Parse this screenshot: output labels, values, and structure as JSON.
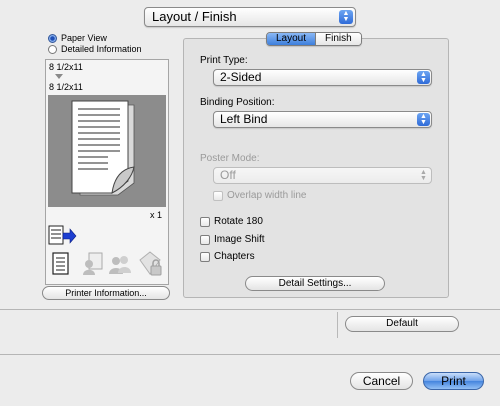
{
  "header": {
    "panel_popup": "Layout / Finish"
  },
  "left_panel": {
    "view_options": [
      {
        "label": "Paper View",
        "selected": true
      },
      {
        "label": "Detailed Information",
        "selected": false
      }
    ],
    "paper_size_top": "8 1/2x11",
    "paper_size_bottom": "8 1/2x11",
    "copies": "x 1",
    "printer_info_button": "Printer Information..."
  },
  "tabs": [
    {
      "label": "Layout",
      "selected": true
    },
    {
      "label": "Finish",
      "selected": false
    }
  ],
  "print_type": {
    "label": "Print Type:",
    "value": "2-Sided"
  },
  "binding_position": {
    "label": "Binding Position:",
    "value": "Left Bind"
  },
  "poster_mode": {
    "label": "Poster Mode:",
    "value": "Off",
    "enabled": false,
    "overlap_label": "Overlap width line"
  },
  "options": [
    {
      "label": "Rotate 180",
      "checked": false
    },
    {
      "label": "Image Shift",
      "checked": false
    },
    {
      "label": "Chapters",
      "checked": false
    }
  ],
  "detail_settings_button": "Detail Settings...",
  "default_button": "Default",
  "footer": {
    "cancel": "Cancel",
    "print": "Print"
  },
  "colors": {
    "accent_blue": "#3d7fdc",
    "window_bg": "#ececec"
  }
}
